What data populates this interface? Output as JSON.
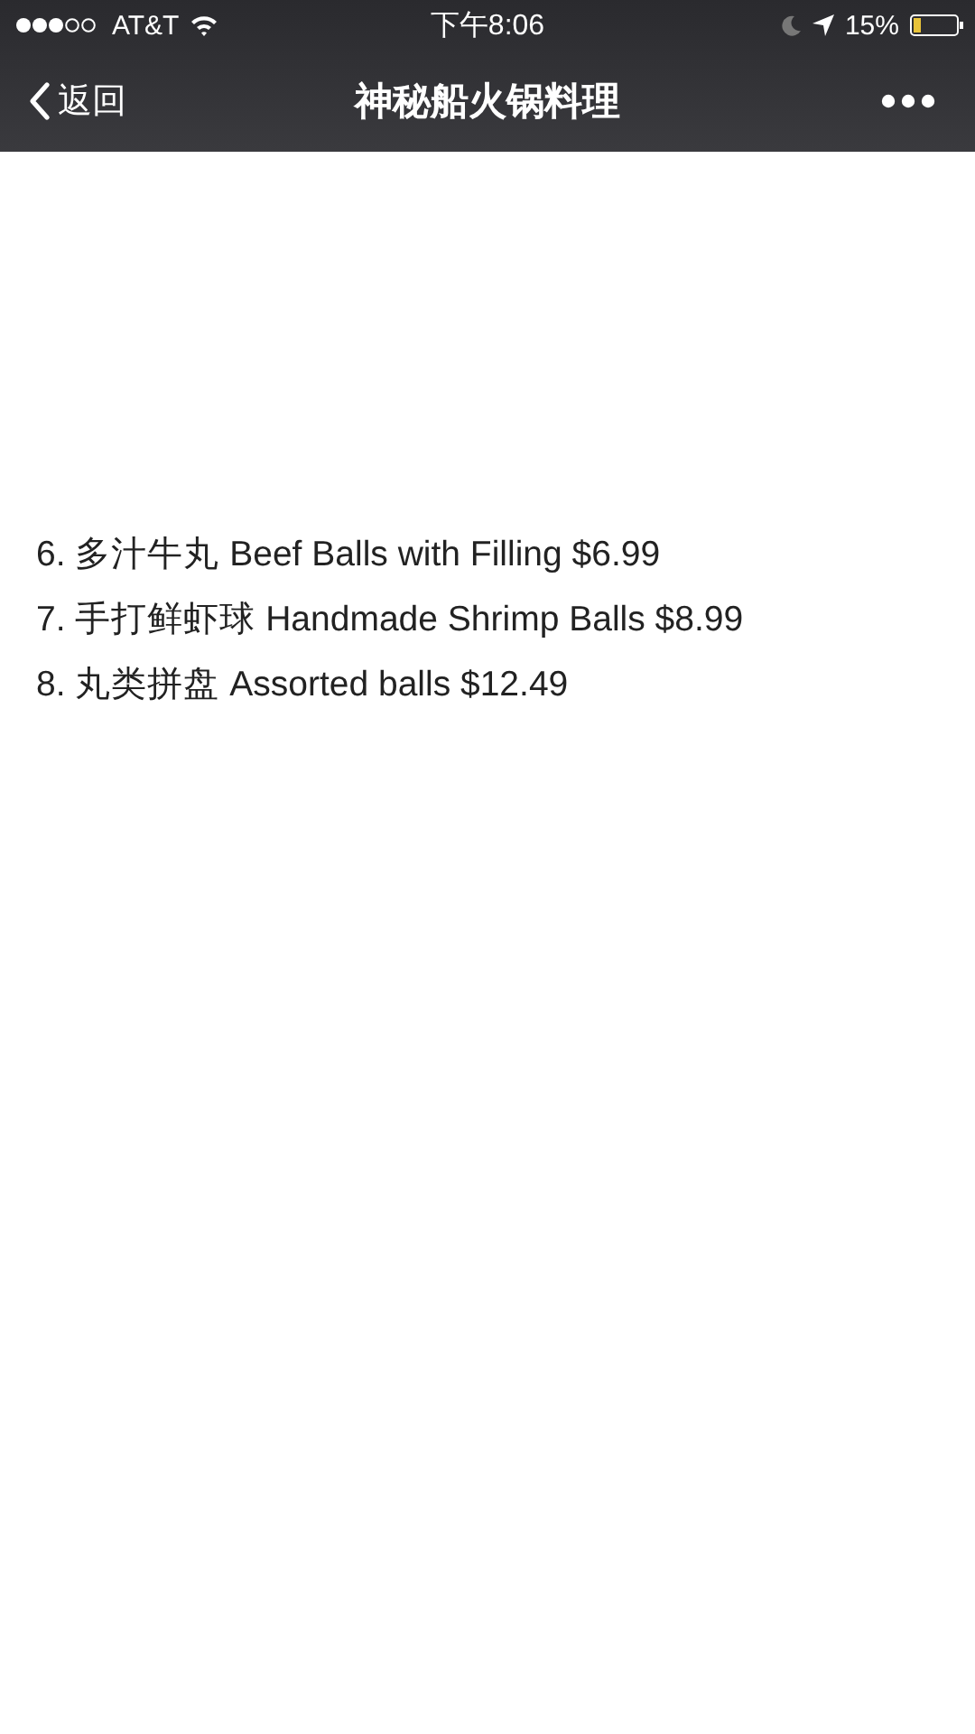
{
  "status_bar": {
    "carrier": "AT&T",
    "time": "下午8:06",
    "battery": "15%"
  },
  "nav_bar": {
    "back": "返回",
    "title": "神秘船火锅料理"
  },
  "menu_items": [
    {
      "text": "6. 多汁牛丸 Beef Balls with Filling $6.99"
    },
    {
      "text": "7. 手打鲜虾球 Handmade Shrimp Balls $8.99"
    },
    {
      "text": "8. 丸类拼盘 Assorted balls $12.49"
    }
  ]
}
